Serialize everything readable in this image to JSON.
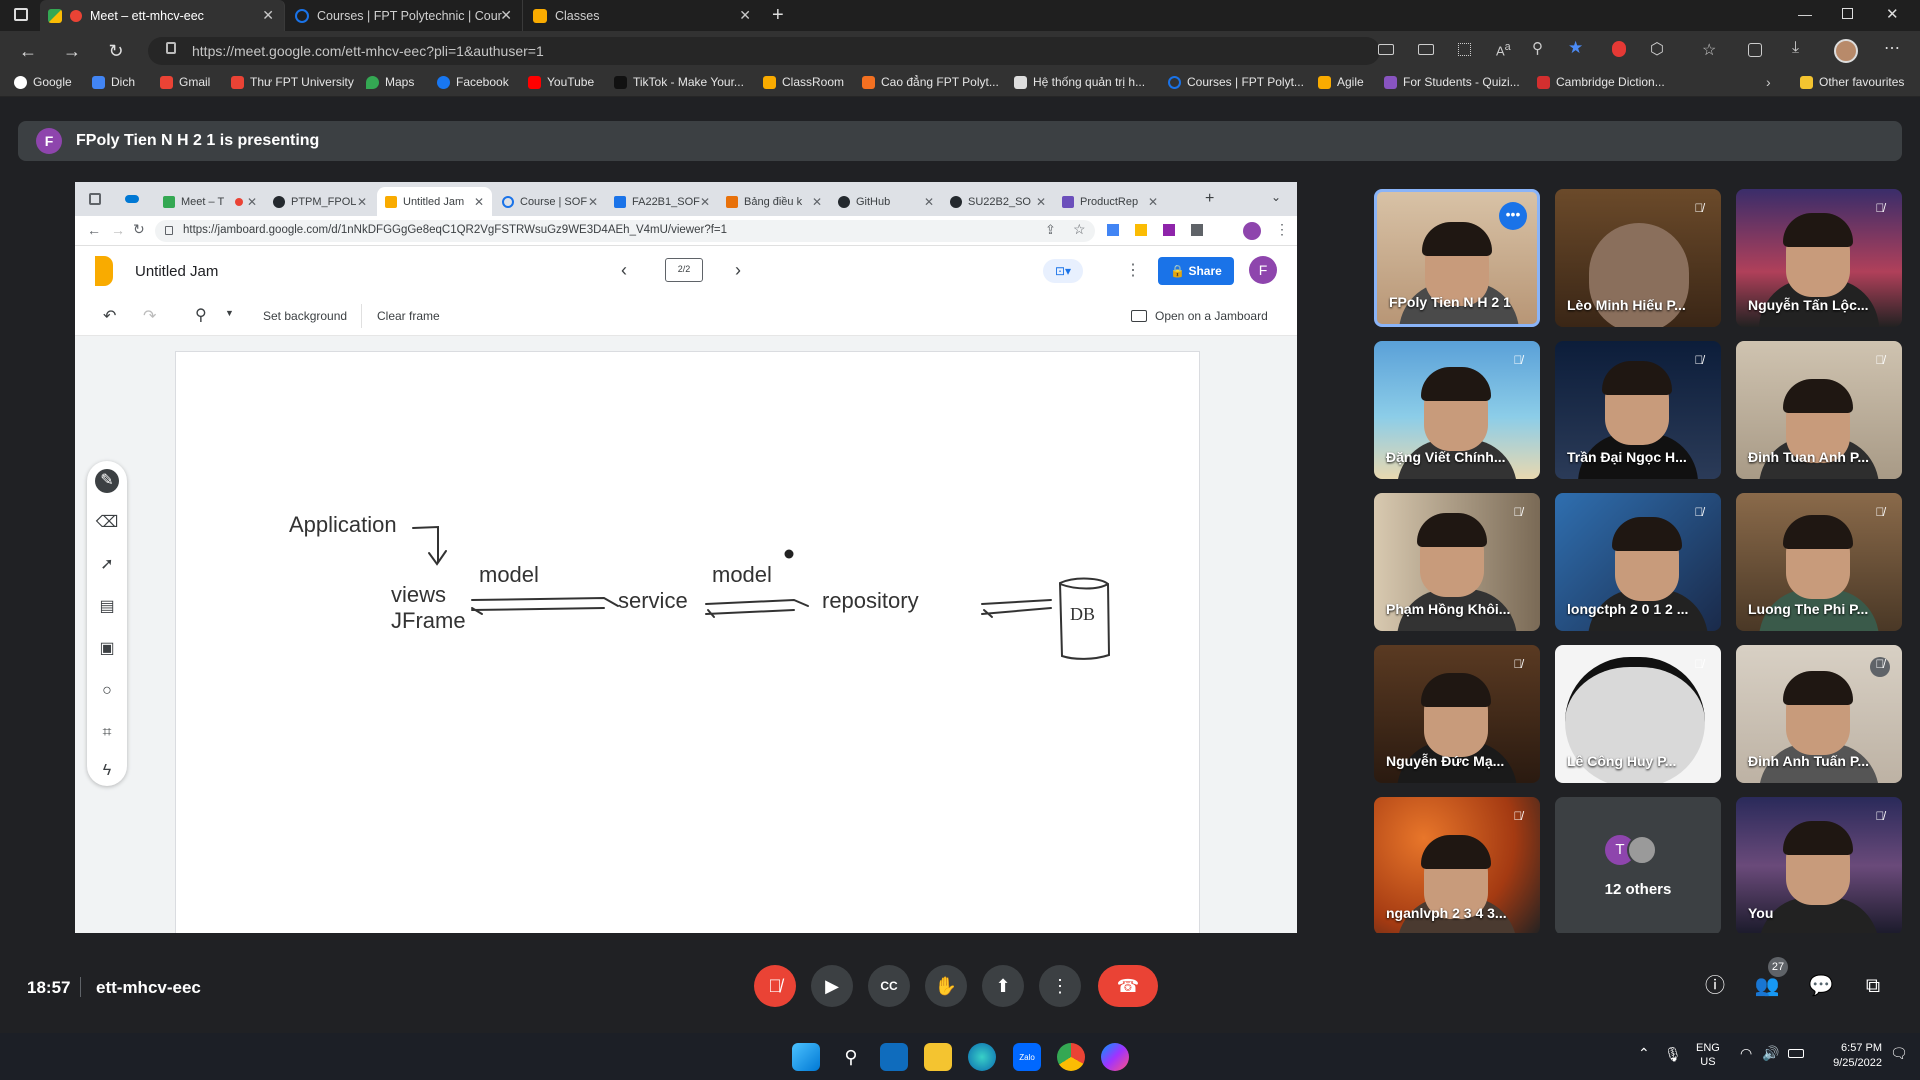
{
  "browser": {
    "tabs": [
      {
        "label": "Meet – ett-mhcv-eec",
        "active": true
      },
      {
        "label": "Courses | FPT Polytechnic | Cour",
        "active": false
      },
      {
        "label": "Classes",
        "active": false
      }
    ],
    "url": "https://meet.google.com/ett-mhcv-eec?pli=1&authuser=1",
    "bookmarks": [
      "Google",
      "Dich",
      "Gmail",
      "Thư FPT University",
      "Maps",
      "Facebook",
      "YouTube",
      "TikTok - Make Your...",
      "ClassRoom",
      "Cao đẳng FPT Polyt...",
      "Hệ thống quản trị h...",
      "Courses | FPT Polyt...",
      "Agile",
      "For Students - Quizi...",
      "Cambridge Diction..."
    ],
    "other_favourites": "Other favourites"
  },
  "meet": {
    "presenter_initial": "F",
    "presenting_text": "FPoly Tien N H 2 1 is presenting",
    "time": "18:57",
    "meeting_code": "ett-mhcv-eec",
    "participant_count": "27",
    "others_initial": "T",
    "others_label": "12 others",
    "participants": [
      "FPoly Tien N H 2 1",
      "Lèo Minh Hiếu P...",
      "Nguyễn Tấn Lộc...",
      "Đặng Viết Chính...",
      "Trần Đại Ngọc H...",
      "Đinh Tuan Anh P...",
      "Phạm Hồng Khôi...",
      "longctph 2 0 1 2 ...",
      "Luong The Phi P...",
      "Nguyễn Đức Mạ...",
      "Lê Công Huy P...",
      "Đinh Anh Tuấn P...",
      "nganlvph 2 3 4 3...",
      "You"
    ]
  },
  "shared": {
    "tabs": [
      "Meet – T",
      "PTPM_FPOL",
      "Untitled Jam",
      "Course | SOF",
      "FA22B1_SOF",
      "Bảng điều k",
      "GitHub",
      "SU22B2_SO",
      "ProductRep"
    ],
    "url": "https://jamboard.google.com/d/1nNkDFGGgGe8eqC1QR2VgFSTRWsuGz9WE3D4AEh_V4mU/viewer?f=1",
    "jam_title": "Untitled Jam",
    "frame_counter": "2/2",
    "share_label": "Share",
    "avatar": "F",
    "set_background": "Set background",
    "clear_frame": "Clear frame",
    "open_jamboard": "Open on a Jamboard",
    "ink": {
      "application": "Application",
      "views": "views",
      "jframe": "JFrame",
      "model1": "model",
      "service": "service",
      "model2": "model",
      "repository": "repository",
      "db": "DB"
    }
  },
  "taskbar": {
    "lang": "ENG",
    "region": "US",
    "time": "6:57 PM",
    "date": "9/25/2022"
  },
  "colors": {
    "meet_bg": "#202124",
    "tile_bg": "#3c4043",
    "end_call": "#ea4335",
    "share_blue": "#1a73e8",
    "jam_yellow": "#f9ab00"
  }
}
